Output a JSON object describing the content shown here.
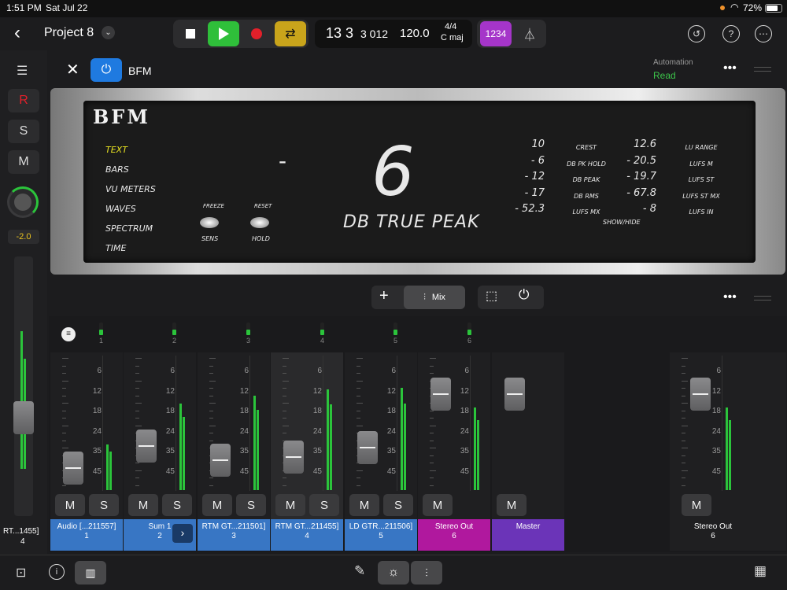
{
  "status": {
    "time": "1:51 PM",
    "date": "Sat Jul 22",
    "battery": "72%"
  },
  "header": {
    "project_title": "Project 8",
    "position": "13 3",
    "sub_position": "3 012",
    "tempo": "120.0",
    "signature": "4/4",
    "key": "C maj",
    "count_in": "1234"
  },
  "left_strip": {
    "record": "R",
    "solo": "S",
    "mute": "M",
    "volume_value": "-2.0",
    "track_name": "RT...1455]",
    "track_number": "4"
  },
  "plugin_header": {
    "plugin_name": "BFM",
    "automation_label": "Automation",
    "automation_mode": "Read"
  },
  "plugin": {
    "logo": "BFM",
    "modes": [
      "TEXT",
      "BARS",
      "VU METERS",
      "WAVES",
      "SPECTRUM",
      "TIME"
    ],
    "knobs": [
      {
        "top": "FREEZE",
        "bottom": "SENS"
      },
      {
        "top": "RESET",
        "bottom": "HOLD"
      }
    ],
    "sign": "-",
    "big_value": "6",
    "big_label": "DB TRUE PEAK",
    "left_values": [
      "10",
      "- 6",
      "- 12",
      "- 17",
      "- 52.3"
    ],
    "mid_labels": [
      "CREST",
      "DB PK HOLD",
      "DB PEAK",
      "DB RMS",
      "LUFS MX"
    ],
    "right_values": [
      "12.6",
      "- 20.5",
      "- 19.7",
      "- 67.8",
      "- 8"
    ],
    "right_labels": [
      "LU RANGE",
      "LUFS M",
      "LUFS ST",
      "LUFS ST MX",
      "LUFS IN"
    ],
    "showhide": "SHOW/HIDE"
  },
  "mixer": {
    "mix_label": "Mix",
    "track_numbers": [
      "1",
      "2",
      "3",
      "4",
      "5",
      "6"
    ],
    "scale": [
      "6",
      "12",
      "18",
      "24",
      "35",
      "45"
    ],
    "mute_label": "M",
    "solo_label": "S",
    "channels": [
      {
        "name": "Audio [...211557]",
        "number": "1",
        "color": "#3876c4"
      },
      {
        "name": "Sum 1",
        "number": "2",
        "color": "#3876c4"
      },
      {
        "name": "RTM GT...211501]",
        "number": "3",
        "color": "#3876c4"
      },
      {
        "name": "RTM GT...211455]",
        "number": "4",
        "color": "#3876c4"
      },
      {
        "name": "LD GTR...211506]",
        "number": "5",
        "color": "#3876c4"
      },
      {
        "name": "Stereo Out",
        "number": "6",
        "color": "#b0189e"
      },
      {
        "name": "Master",
        "number": "",
        "color": "#6b34b8"
      }
    ],
    "pinned": {
      "name": "Stereo Out",
      "number": "6"
    }
  },
  "colors": {
    "play": "#2fbf3a",
    "record": "#e2202a",
    "cycle": "#c9a41b",
    "count_in": "#a535c9",
    "power": "#1f7ae0",
    "automation_read": "#3cc34a"
  }
}
